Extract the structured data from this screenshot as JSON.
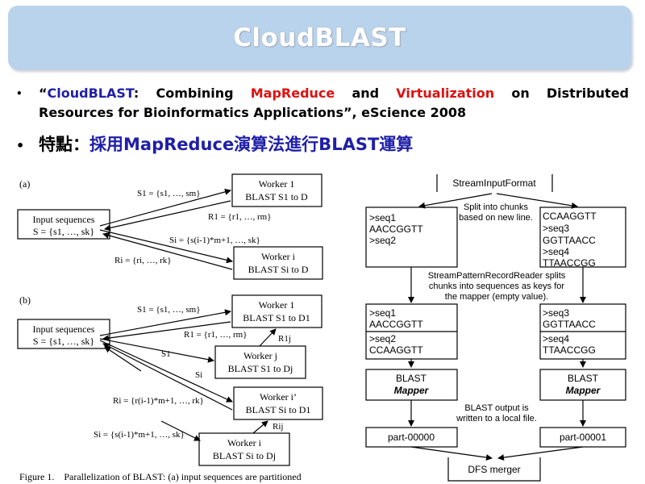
{
  "slide": {
    "title": "CloudBLAST",
    "bullet1": {
      "quote_open": "“",
      "name": "CloudBLAST",
      "colon": ": Combining ",
      "term1": "MapReduce",
      "and": " and ",
      "term2": "Virtualization",
      "rest": " on Distributed Resources for Bioinformatics Applications”, eScience 2008"
    },
    "bullet2": {
      "label": "特點：",
      "value": "採用MapReduce演算法進行BLAST運算"
    },
    "colors": {
      "title_bg": "#b9d3ec",
      "blue": "#1f1fa8",
      "red": "#e01010"
    }
  },
  "figure_left": {
    "a_label": "(a)",
    "b_label": "(b)",
    "input_line1": "Input sequences",
    "input_line2": "S = {s1, …, sk}",
    "a": {
      "worker1_l1": "Worker 1",
      "worker1_l2": "BLAST S1 to D",
      "workeri_l1": "Worker i",
      "workeri_l2": "BLAST Si to D",
      "s1": "S1 = {s1, …, sm}",
      "r1": "R1 = {r1, …, rm}",
      "si": "Si = {s(i-1)*m+1, …, sk}",
      "ri": "Ri = {ri, …, rk}"
    },
    "b": {
      "worker1_l1": "Worker 1",
      "worker1_l2": "BLAST S1 to D1",
      "workerj_l1": "Worker j",
      "workerj_l2": "BLAST S1 to Dj",
      "workeri2_l1": "Worker i’",
      "workeri2_l2": "BLAST Si to D1",
      "workeri_l1": "Worker i",
      "workeri_l2": "BLAST Si to Dj",
      "s1": "S1 = {s1, …, sm}",
      "r1": "R1 = {r1, …, rm}",
      "r1j": "R1j",
      "s1_short": "S1",
      "si_short": "Si",
      "ri": "Ri = {r(i-1)*m+1, …, rk}",
      "rij": "Rij",
      "si": "Si = {s(i-1)*m+1, …, sk}"
    },
    "caption": "Figure 1.    Parallelization of BLAST: (a) input sequences are partitioned"
  },
  "figure_right": {
    "input_format": "StreamInputFormat",
    "split_note_l1": "Split into chunks",
    "split_note_l2": "based on new line.",
    "chunk1": [
      ">seq1",
      "AACCGGTT",
      ">seq2"
    ],
    "chunk2": [
      "CCAAGGTT",
      ">seq3",
      "GGTTAACC",
      ">seq4",
      "TTAACCGG"
    ],
    "reader_note_l1": "StreamPatternRecordReader splits",
    "reader_note_l2": "chunks into sequences as keys for",
    "reader_note_l3": "the mapper (empty value).",
    "rec_left": [
      [
        ">seq1",
        "AACCGGTT"
      ],
      [
        ">seq2",
        "CCAAGGTT"
      ]
    ],
    "rec_right": [
      [
        ">seq3",
        "GGTTAACC"
      ],
      [
        ">seq4",
        "TTAACCGG"
      ]
    ],
    "mapper_l1": "BLAST",
    "mapper_l2": "Mapper",
    "output_note_l1": "BLAST output is",
    "output_note_l2": "written to a local file.",
    "part0": "part-00000",
    "part1": "part-00001",
    "merger": "DFS merger"
  }
}
